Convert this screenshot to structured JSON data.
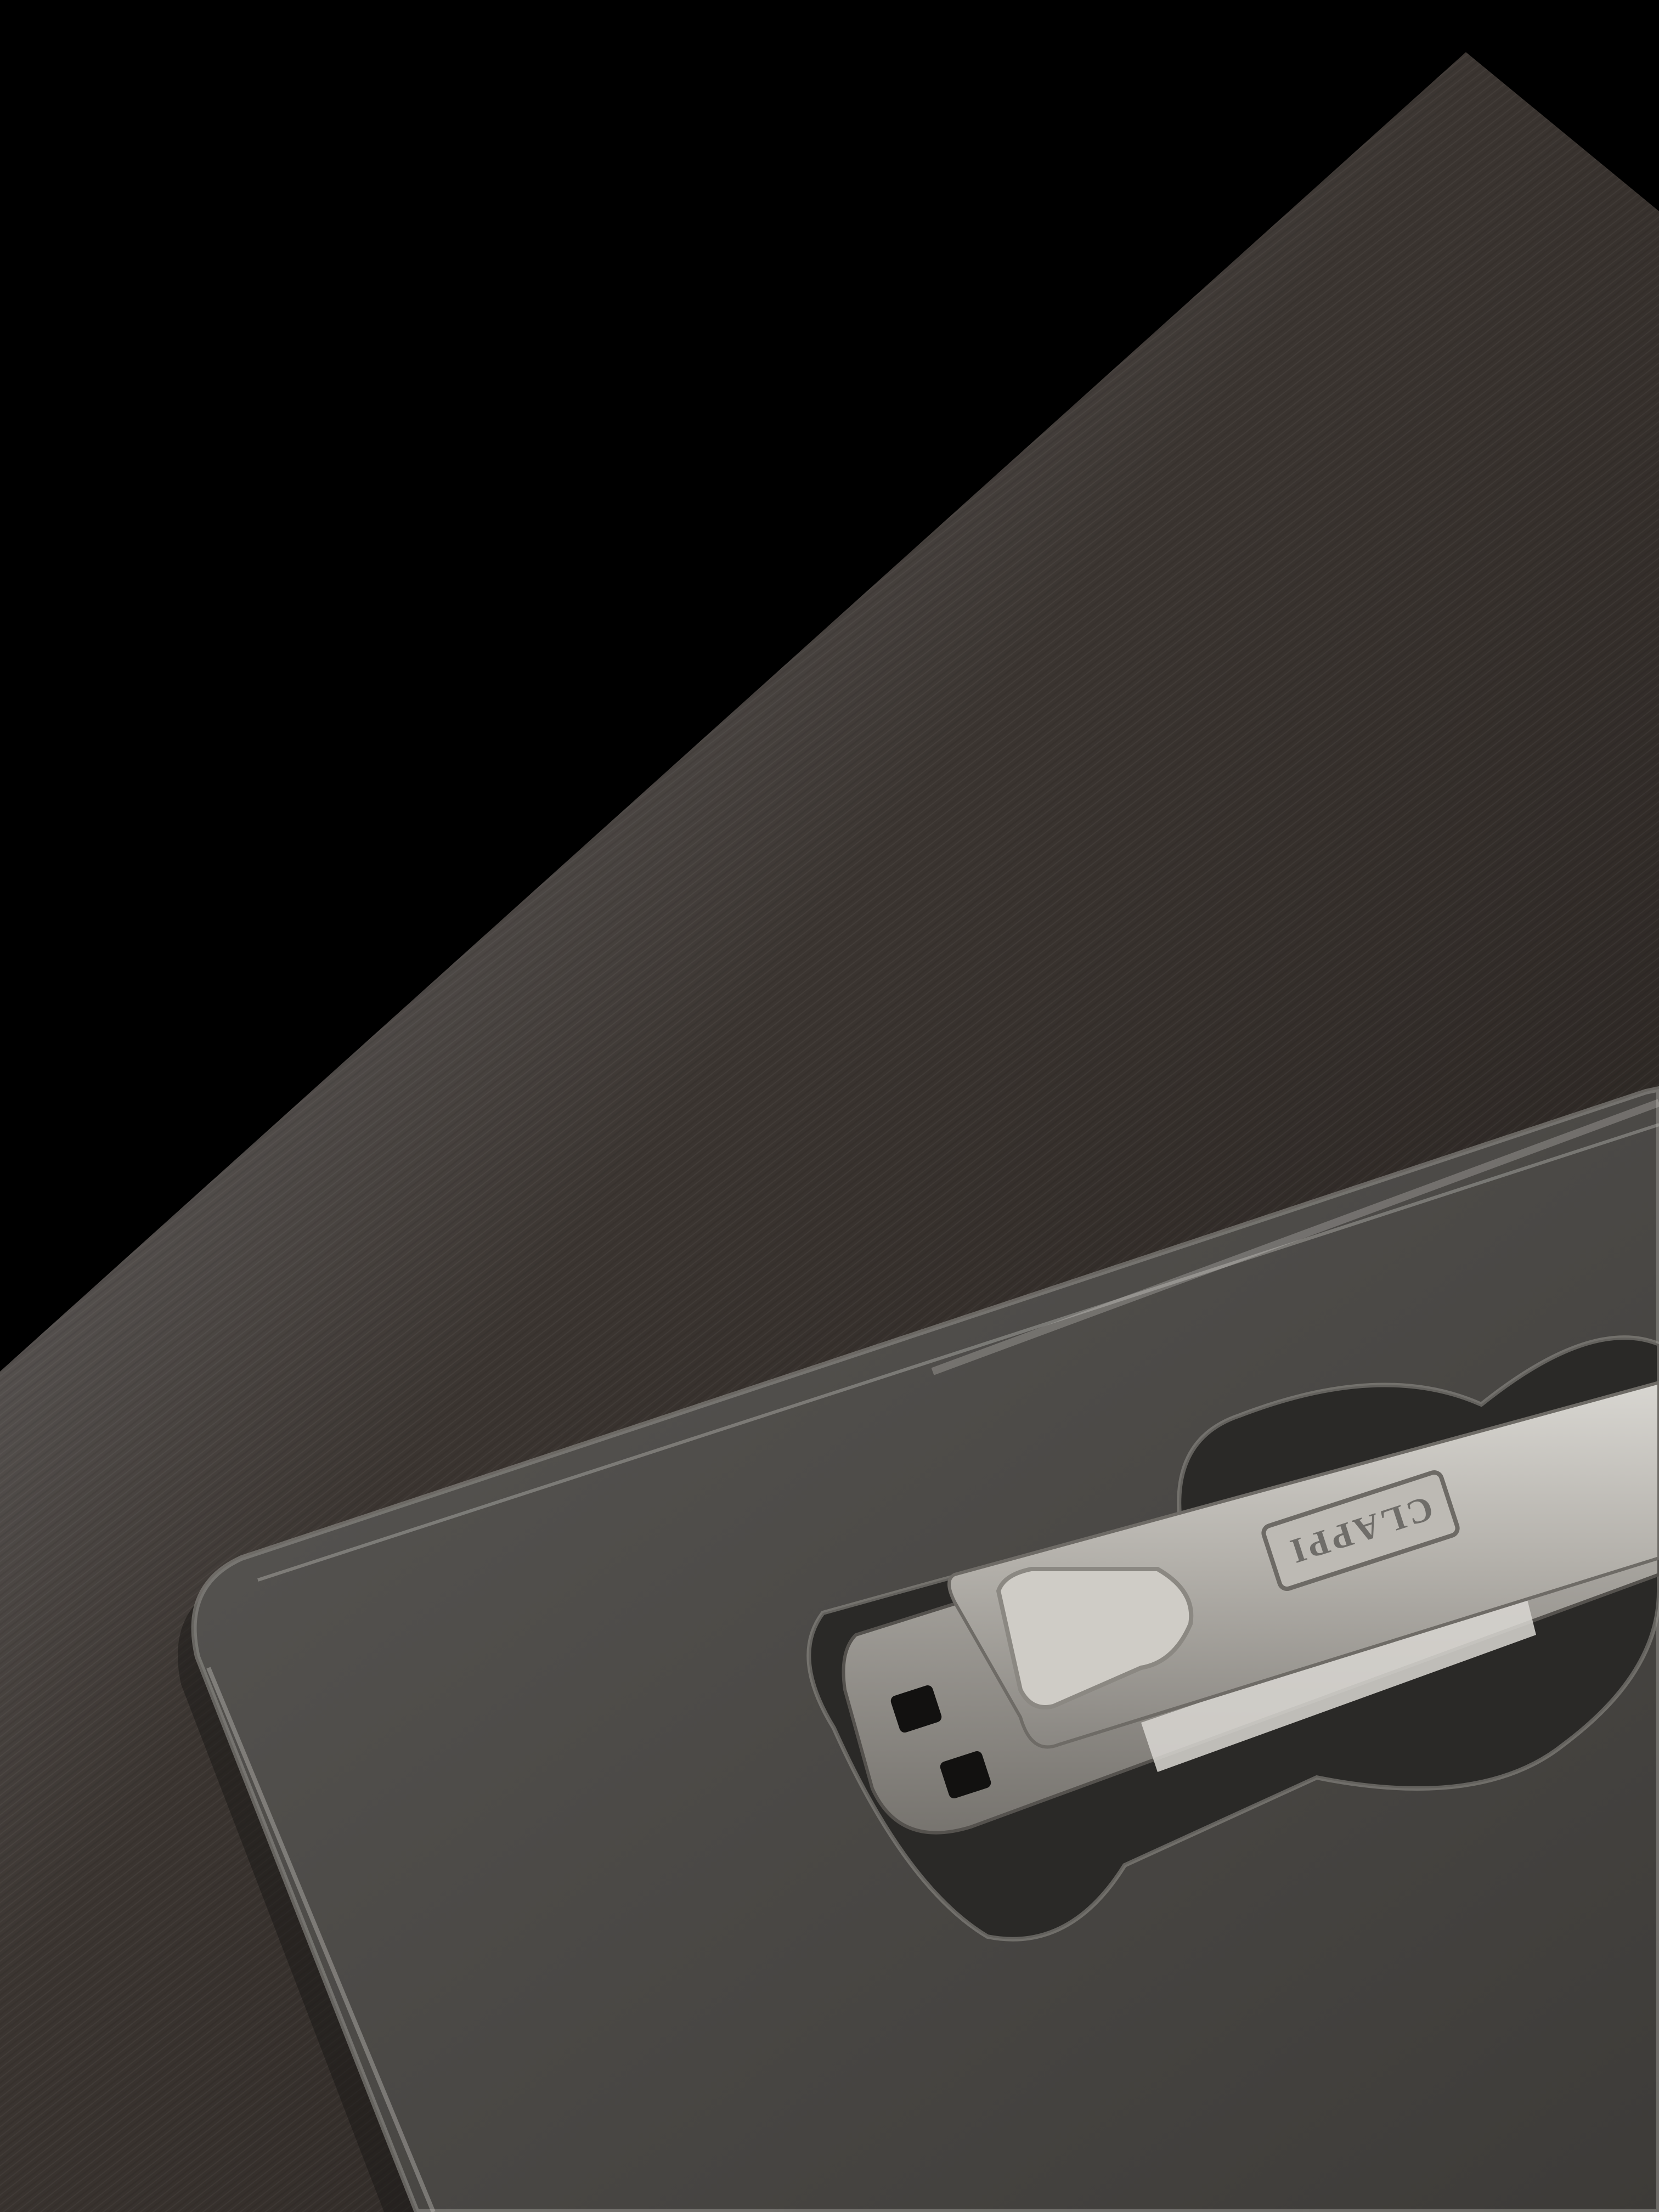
{
  "scene": {
    "description_label": "",
    "brand_engraving": "CLAPPI",
    "colors": {
      "background_black": "#000000",
      "table_wood_dark": "#2b2724",
      "table_wood_light": "#6b6761",
      "tray_plastic": "#4a4845",
      "clipper_metal": "#b9b6b0",
      "clipper_shadow": "#7d7a75"
    }
  }
}
